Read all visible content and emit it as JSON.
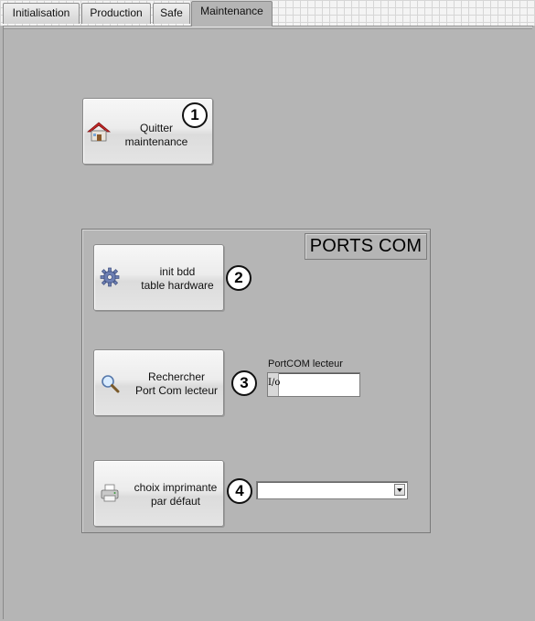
{
  "tabs": [
    {
      "label": "Initialisation",
      "active": false
    },
    {
      "label": "Production",
      "active": false
    },
    {
      "label": "Safe",
      "active": false
    },
    {
      "label": "Maintenance",
      "active": true
    }
  ],
  "quit_button": {
    "line1": "Quitter",
    "line2": "maintenance",
    "badge": "1",
    "icon": "home-icon"
  },
  "ports_group": {
    "title": "PORTS COM"
  },
  "init_button": {
    "line1": "init bdd",
    "line2": "table hardware",
    "badge": "2",
    "icon": "gear-icon"
  },
  "search_button": {
    "line1": "Rechercher",
    "line2": "Port Com lecteur",
    "badge": "3",
    "icon": "magnifier-icon"
  },
  "portcom_field": {
    "label": "PortCOM lecteur",
    "prefix": "I/o",
    "value": ""
  },
  "printer_button": {
    "line1": "choix imprimante",
    "line2": "par défaut",
    "badge": "4",
    "icon": "printer-icon"
  },
  "printer_select": {
    "value": ""
  }
}
